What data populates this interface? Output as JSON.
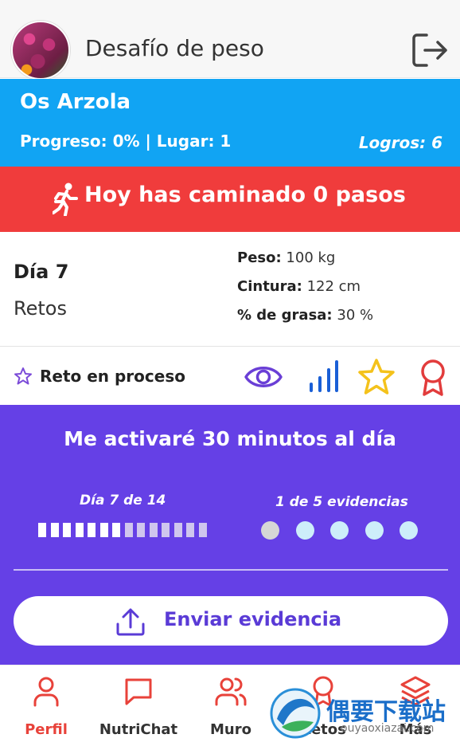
{
  "header": {
    "title": "Desafío de peso",
    "avatar_icon": "flowers-avatar",
    "logout_icon": "logout-icon"
  },
  "profile": {
    "name": "Os Arzola",
    "progress_text": "Progreso: 0% | Lugar: 1",
    "logros_text": "Logros: 6",
    "bg_color": "#11a4f3"
  },
  "steps": {
    "icon": "walking-icon",
    "text": "Hoy has caminado 0 pasos",
    "bg_color": "#f03c3c"
  },
  "stats": {
    "day": "Día 7",
    "retos": "Retos",
    "peso_label": "Peso:",
    "peso_value": "100 kg",
    "cintura_label": "Cintura:",
    "cintura_value": "122 cm",
    "grasa_label": "% de grasa:",
    "grasa_value": "30 %"
  },
  "reto_bar": {
    "label": "Reto en proceso",
    "icons": [
      "eye-icon",
      "bar-chart-icon",
      "star-icon",
      "award-icon"
    ]
  },
  "challenge": {
    "title": "Me activaré 30 minutos al día",
    "day_progress": "Día 7 de 14",
    "days_done": 7,
    "days_total": 14,
    "evidence_progress": "1 de 5 evidencias",
    "evidence_done": 1,
    "evidence_total": 5,
    "send_label": "Enviar evidencia",
    "bg_color": "#6540e6"
  },
  "nav": {
    "items": [
      {
        "label": "Perfil",
        "icon": "user-icon",
        "active": true
      },
      {
        "label": "NutriChat",
        "icon": "chat-icon",
        "active": false
      },
      {
        "label": "Muro",
        "icon": "users-icon",
        "active": false
      },
      {
        "label": "Retos",
        "icon": "award-icon",
        "active": false
      },
      {
        "label": "Más",
        "icon": "layers-icon",
        "active": false
      }
    ],
    "active_color": "#e8423a"
  },
  "watermark": {
    "cn": "偶要下载站",
    "en": "ouyaoxiazai.com"
  }
}
